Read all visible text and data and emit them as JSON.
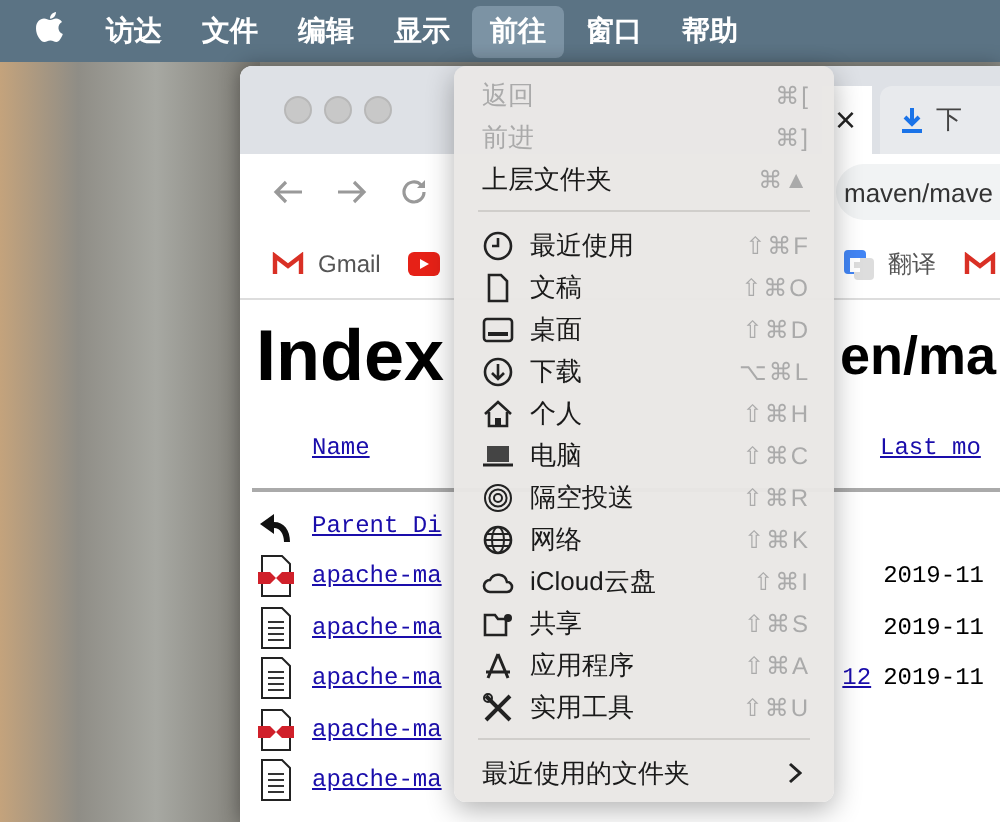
{
  "menu_bar": {
    "items": [
      {
        "label": "访达",
        "selected": false
      },
      {
        "label": "文件",
        "selected": false
      },
      {
        "label": "编辑",
        "selected": false
      },
      {
        "label": "显示",
        "selected": false
      },
      {
        "label": "前往",
        "selected": true
      },
      {
        "label": "窗口",
        "selected": false
      },
      {
        "label": "帮助",
        "selected": false
      }
    ]
  },
  "browser": {
    "tabs": [
      {
        "label": "×",
        "kind": "close"
      },
      {
        "label": "下",
        "kind": "download"
      }
    ],
    "address": "maven/mave",
    "bookmarks": [
      {
        "label": "Gmail",
        "kind": "gmail"
      },
      {
        "kind": "youtube"
      },
      {
        "label": "翻译",
        "kind": "translate"
      },
      {
        "kind": "gmail"
      }
    ],
    "heading_left": "Index",
    "heading_right": "en/ma",
    "columns": [
      {
        "label": "Name"
      },
      {
        "label": "Last mo"
      }
    ],
    "rows": [
      {
        "kind": "back",
        "name": "Parent Di",
        "name_tail": "",
        "date": ""
      },
      {
        "kind": "jar",
        "name": "apache-ma",
        "name_tail": "",
        "date": "2019-11"
      },
      {
        "kind": "text",
        "name": "apache-ma",
        "name_tail": "",
        "date": "2019-11"
      },
      {
        "kind": "text",
        "name": "apache-ma",
        "name_tail": "12",
        "date": "2019-11"
      },
      {
        "kind": "jar",
        "name": "apache-ma",
        "name_tail": "",
        "date": ""
      },
      {
        "kind": "text",
        "name": "apache-ma",
        "name_tail": "",
        "date": ""
      }
    ]
  },
  "go_menu": {
    "items": [
      {
        "kind": "item",
        "label": "返回",
        "shortcut": "⌘[",
        "disabled": true
      },
      {
        "kind": "item",
        "label": "前进",
        "shortcut": "⌘]",
        "disabled": true
      },
      {
        "kind": "item",
        "label": "上层文件夹",
        "shortcut": "⌘▲",
        "disabled": false
      },
      {
        "kind": "separator"
      },
      {
        "kind": "item",
        "label": "最近使用",
        "shortcut": "⇧⌘F",
        "disabled": false
      },
      {
        "kind": "item",
        "label": "文稿",
        "shortcut": "⇧⌘O",
        "disabled": false
      },
      {
        "kind": "item",
        "label": "桌面",
        "shortcut": "⇧⌘D",
        "disabled": false
      },
      {
        "kind": "item",
        "label": "下载",
        "shortcut": "⌥⌘L",
        "disabled": false
      },
      {
        "kind": "item",
        "label": "个人",
        "shortcut": "⇧⌘H",
        "disabled": false
      },
      {
        "kind": "item",
        "label": "电脑",
        "shortcut": "⇧⌘C",
        "disabled": false
      },
      {
        "kind": "item",
        "label": "隔空投送",
        "shortcut": "⇧⌘R",
        "disabled": false
      },
      {
        "kind": "item",
        "label": "网络",
        "shortcut": "⇧⌘K",
        "disabled": false
      },
      {
        "kind": "item",
        "label": "iCloud云盘",
        "shortcut": "⇧⌘I",
        "disabled": false
      },
      {
        "kind": "item",
        "label": "共享",
        "shortcut": "⇧⌘S",
        "disabled": false
      },
      {
        "kind": "item",
        "label": "应用程序",
        "shortcut": "⇧⌘A",
        "disabled": false
      },
      {
        "kind": "item",
        "label": "实用工具",
        "shortcut": "⇧⌘U",
        "disabled": false
      },
      {
        "kind": "separator"
      },
      {
        "kind": "submenu",
        "label": "最近使用的文件夹",
        "disabled": false
      }
    ]
  }
}
